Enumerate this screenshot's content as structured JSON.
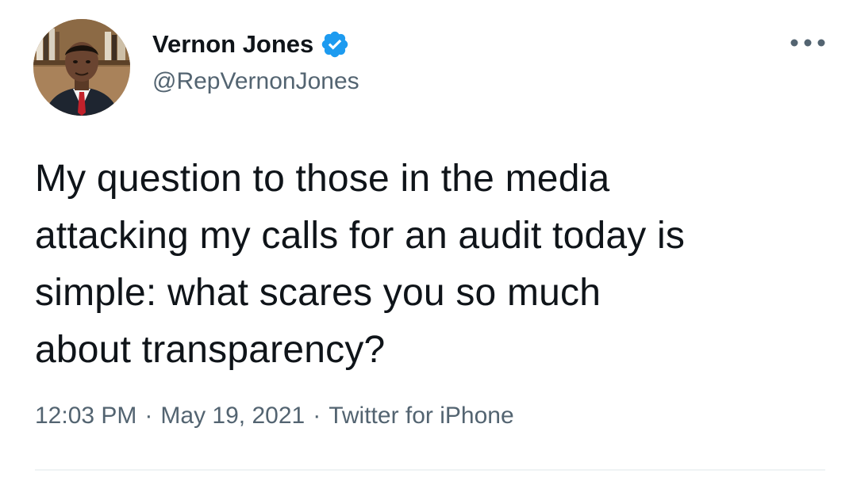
{
  "author": {
    "display_name": "Vernon Jones",
    "handle": "@RepVernonJones",
    "verified_icon": "verified-badge-icon",
    "avatar_icon": "profile-photo"
  },
  "tweet": {
    "text_lines": [
      "My question to those in the media",
      "attacking my calls for an audit today is",
      "simple: what scares you so much",
      "about transparency?"
    ]
  },
  "meta": {
    "time": "12:03 PM",
    "separator": "·",
    "date": "May 19, 2021",
    "source": "Twitter for iPhone"
  },
  "colors": {
    "text_primary": "#0f1419",
    "text_secondary": "#536471",
    "verified_blue": "#1d9bf0",
    "divider": "#eff3f4"
  },
  "menu": {
    "more_icon": "more-options-icon"
  }
}
